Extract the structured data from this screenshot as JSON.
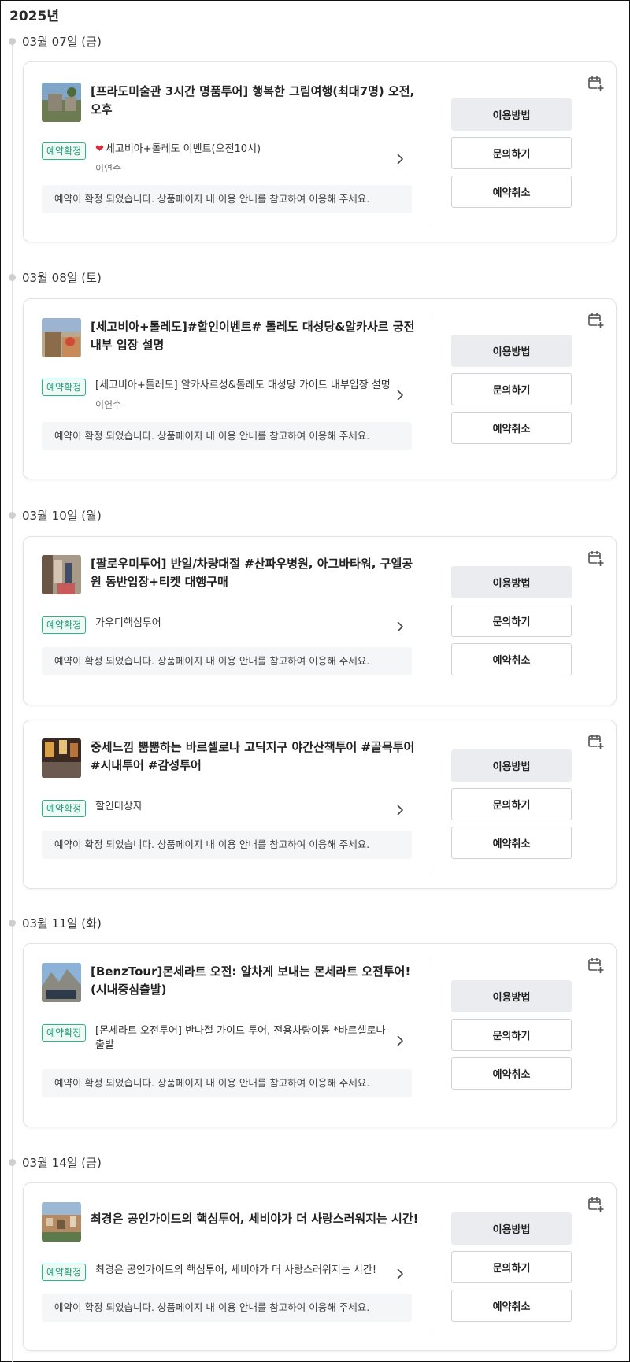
{
  "year": "2025년",
  "labels": {
    "usage": "이용방법",
    "inquiry": "문의하기",
    "cancel": "예약취소",
    "badge": "예약확정",
    "notice": "예약이 확정 되었습니다. 상품페이지 내 이용 안내를 참고하여 이용해 주세요."
  },
  "icons": {
    "calendar": "calendar-plus-icon",
    "chevron": "chevron-right-icon",
    "heart": "heart-icon"
  },
  "colors": {
    "badge_border": "#2bb38a",
    "badge_text": "#1f9a74",
    "primary_button": "#eaecef",
    "heart": "#e02a3a"
  },
  "dates": [
    "03월 07일 (금)",
    "03월 08일 (토)",
    "03월 10일 (월)",
    "03월 11일 (화)",
    "03월 14일 (금)"
  ],
  "bookings": [
    {
      "title": "[프라도미술관 3시간 명품투어] 행복한 그림여행(최대7명) 오전, 오후",
      "option": "세고비아+톨레도 이벤트(오전10시)",
      "guest": "이연수"
    },
    {
      "title": "[세고비아+톨레도]#할인이벤트# 톨레도 대성당&알카사르 궁전 내부 입장 설명",
      "option": "[세고비아+톨레도] 알카사르성&톨레도 대성당 가이드 내부입장 설명",
      "guest": "이연수"
    },
    {
      "title": "[팔로우미투어] 반일/차량대절 #산파우병원, 아그바타워, 구엘공원 동반입장+티켓 대행구매",
      "option": "가우디핵심투어",
      "guest": ""
    },
    {
      "title": "중세느낌 뿜뿜하는 바르셀로나 고딕지구 야간산책투어 #골목투어 #시내투어 #감성투어",
      "option": "할인대상자",
      "guest": ""
    },
    {
      "title": "[BenzTour]몬세라트 오전: 알차게 보내는 몬세라트 오전투어! (시내중심출발)",
      "option": "[몬세라트 오전투어] 반나절 가이드 투어, 전용차량이동 *바르셀로나 출발",
      "guest": ""
    },
    {
      "title": "최경은 공인가이드의 핵심투어, 세비야가 더 사랑스러워지는 시간!",
      "option": "최경은 공인가이드의 핵심투어, 세비야가 더 사랑스러워지는 시간!",
      "guest": ""
    }
  ]
}
